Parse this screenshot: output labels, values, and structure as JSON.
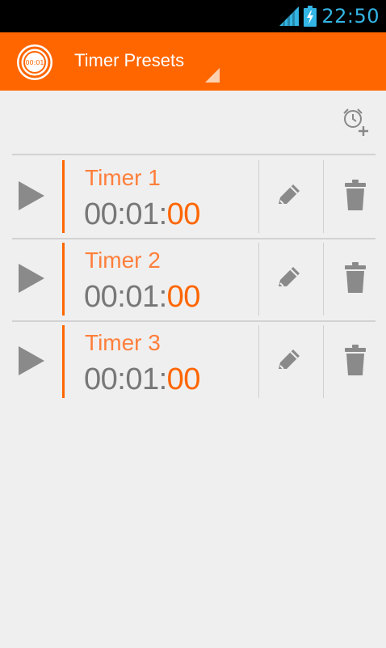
{
  "status": {
    "time": "22:50",
    "signal_icon": "signal-icon",
    "battery_icon": "battery-charging-icon"
  },
  "action_bar": {
    "title": "Timer Presets",
    "logo_text": "00:01"
  },
  "toolbar": {
    "add_icon": "add-alarm-icon"
  },
  "presets": [
    {
      "name": "Timer 1",
      "hm": "00:01:",
      "sec": "00"
    },
    {
      "name": "Timer 2",
      "hm": "00:01:",
      "sec": "00"
    },
    {
      "name": "Timer 3",
      "hm": "00:01:",
      "sec": "00"
    }
  ],
  "colors": {
    "accent": "#ff6600",
    "status_clock": "#33b5e5",
    "background": "#efefef"
  }
}
